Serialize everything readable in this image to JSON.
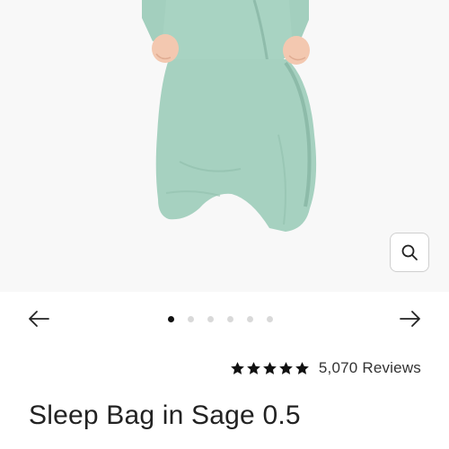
{
  "gallery": {
    "image_alt": "Baby wearing a sage sleep bag",
    "slide_count": 6,
    "active_slide": 1
  },
  "rating": {
    "stars": 5,
    "reviews_label": "5,070 Reviews"
  },
  "product": {
    "title": "Sleep Bag in Sage 0.5"
  },
  "icons": {
    "zoom": "search-icon",
    "prev": "arrow-left-icon",
    "next": "arrow-right-icon",
    "star": "star-icon"
  },
  "colors": {
    "sage": "#a6d1c0",
    "text": "#222222",
    "dot_active": "#111111",
    "dot_inactive": "#d9d9d9"
  }
}
